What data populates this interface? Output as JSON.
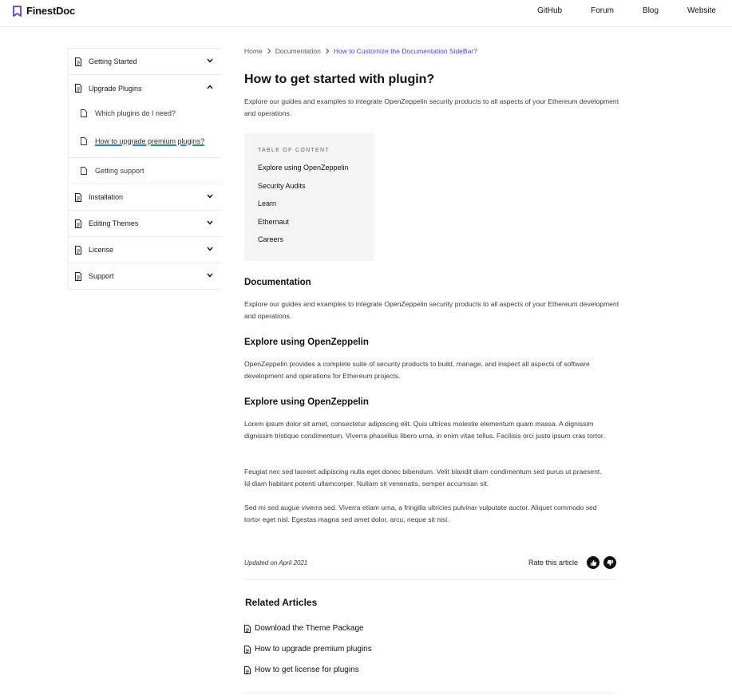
{
  "header": {
    "brand": "FinestDoc",
    "brand_color": "#5b3ce6",
    "nav": [
      "GitHub",
      "Forum",
      "Blog",
      "Website"
    ]
  },
  "sidebar": {
    "items": [
      {
        "label": "Getting Started",
        "icon": "document-icon",
        "expanded": false
      },
      {
        "label": "Upgrade Plugins",
        "icon": "document-icon",
        "expanded": true,
        "children": [
          {
            "label": "Which plugins do I need?"
          },
          {
            "label": "How to upgrade premium plugins?",
            "active": true
          },
          {
            "label": "Getting support"
          }
        ]
      },
      {
        "label": "Installation",
        "icon": "document-icon",
        "expanded": false
      },
      {
        "label": "Editing Themes",
        "icon": "document-icon",
        "expanded": false
      },
      {
        "label": "License",
        "icon": "document-icon",
        "expanded": false
      },
      {
        "label": "Support",
        "icon": "document-icon",
        "expanded": false
      }
    ]
  },
  "breadcrumb": {
    "home": "Home",
    "section": "Documentation",
    "current": "How to Customize the Documentation SideBar?"
  },
  "article": {
    "title": "How to get started with plugin?",
    "intro": "Explore our guides and examples to integrate OpenZeppelin security products to all aspects of your Ethereum development and operations.",
    "toc": {
      "title": "TABLE OF CONTENT",
      "items": [
        "Explore using OpenZeppelin",
        "Security Audits",
        "Learn",
        "Ethernaut",
        "Careers"
      ]
    },
    "sections": [
      {
        "heading": "Documentation",
        "paragraphs": [
          "Explore our guides and examples to integrate OpenZeppelin security products to all aspects of your Ethereum development and operations."
        ]
      },
      {
        "heading": "Explore using OpenZeppelin",
        "paragraphs": [
          "OpenZeppelin provides a complete suite of security products to build, manage, and inspect all aspects of software development and operations for Ethereum projects."
        ]
      },
      {
        "heading": "Explore using OpenZeppelin",
        "paragraphs": [
          "Lorem ipsum dolor sit amet, consectetur adipiscing elit. Quis ultrices molestie elementum quam massa. A dignissim dignissim tristique condimentum. Viverra phasellus libero urna, in enim vitae tellus. Facilisis orci justo ipsum cras tortor.",
          "Feugiat nec sed laoreet adipiscing nulla eget donec bibendum. Velit blandit diam condimentum sed purus ut praesent. Id diam habitant potenti ullamcorper. Nullam sit venenatis, semper accumsan sit.",
          "Sed mi sed augue viverra sed. Viverra etiam urna, a fringilla ultricies pulvinar vulputate auctor. Aliquet commodo sed tortor eget nisl. Egestas magna sed amet dolor, arcu, neque sit nisi."
        ]
      }
    ],
    "updated": "Updated on April 2021",
    "rate_label": "Rate this article"
  },
  "related": {
    "title": "Related Articles",
    "items": [
      "Download the Theme Package",
      "How to upgrade premium plugins",
      "How to get license for plugins"
    ]
  }
}
